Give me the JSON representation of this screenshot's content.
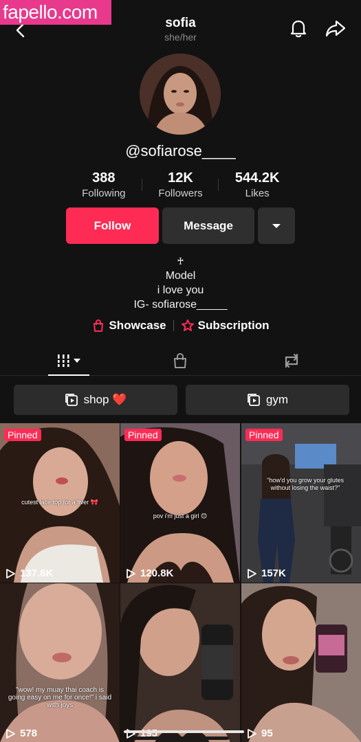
{
  "watermark": "fapello.com",
  "header": {
    "title": "sofia",
    "pronouns": "she/her"
  },
  "profile": {
    "username": "@sofiarose____",
    "stats": [
      {
        "value": "388",
        "label": "Following"
      },
      {
        "value": "12K",
        "label": "Followers"
      },
      {
        "value": "544.2K",
        "label": "Likes"
      }
    ],
    "follow_label": "Follow",
    "message_label": "Message",
    "bio": {
      "symbol": "♰",
      "line1": "Model",
      "line2": "i love you",
      "line3": "IG- sofiarose_____"
    },
    "links": {
      "showcase": "Showcase",
      "subscription": "Subscription"
    }
  },
  "tabs": {
    "videos_icon": "grid-icon",
    "shop_icon": "shopping-bag-icon",
    "repost_icon": "repost-icon"
  },
  "playlists": [
    {
      "label": "shop ❤️"
    },
    {
      "label": "gym"
    }
  ],
  "videos": [
    {
      "pinned": "Pinned",
      "views": "137.6K",
      "caption": "cutest lace top for a fiver 🎀"
    },
    {
      "pinned": "Pinned",
      "views": "120.8K",
      "caption": "pov i'm just a girl 😊"
    },
    {
      "pinned": "Pinned",
      "views": "157K",
      "caption": "\"how'd you grow your glutes without losing the waist?\""
    },
    {
      "pinned": "",
      "views": "578",
      "caption": "\"wow! my muay thai coach is going easy on me for once!\"   i said with joys"
    },
    {
      "pinned": "",
      "views": "195",
      "caption": ""
    },
    {
      "pinned": "",
      "views": "95",
      "caption": ""
    }
  ],
  "colors": {
    "accent": "#fe2c55",
    "background": "#121212",
    "watermark": "#e8398d"
  }
}
